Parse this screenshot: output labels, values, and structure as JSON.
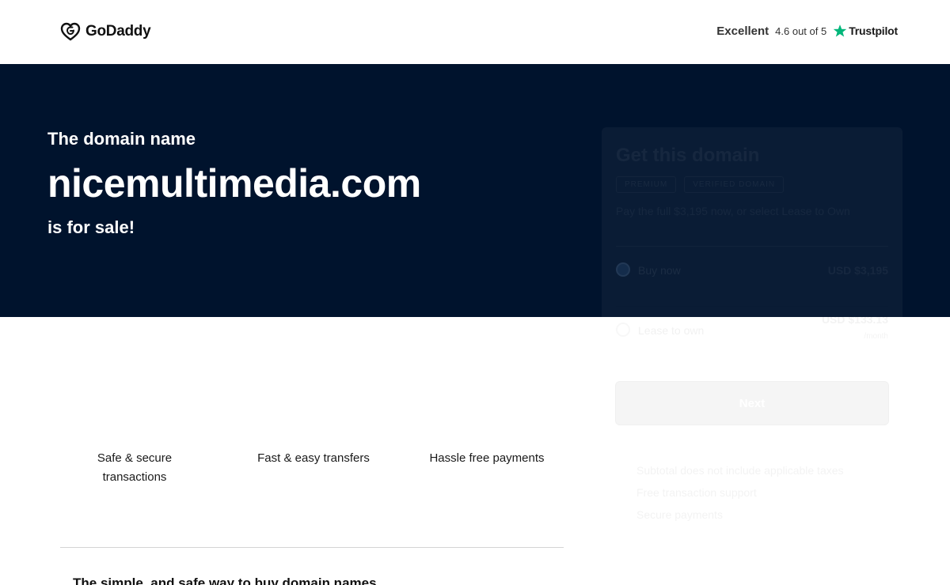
{
  "header": {
    "logo_text": "GoDaddy",
    "rating": {
      "label": "Excellent",
      "score": "4.6 out of 5",
      "provider": "Trustpilot",
      "star_color": "#00b67a"
    }
  },
  "hero": {
    "pre_text": "The domain name",
    "domain": "nicemultimedia.com",
    "post_text": "is for sale!",
    "background": "#00132d"
  },
  "purchase_card": {
    "title": "Get this domain",
    "badges": [
      "PREMIUM",
      "VERIFIED DOMAIN"
    ],
    "subtitle": "Pay the full $3,195 now, or select Lease to Own",
    "options": [
      {
        "label": "Buy now",
        "price": "USD $3,195",
        "selected": true
      },
      {
        "label": "Lease to own",
        "price": "USD $133.13",
        "note": "/month",
        "selected": false
      }
    ],
    "next_label": "Next",
    "features": [
      "Subtotal does not include applicable taxes",
      "Free transaction support",
      "Secure payments"
    ]
  },
  "features": [
    "Safe & secure transactions",
    "Fast & easy transfers",
    "Hassle free payments"
  ],
  "bottom_heading": "The simple, and safe way to buy domain names"
}
